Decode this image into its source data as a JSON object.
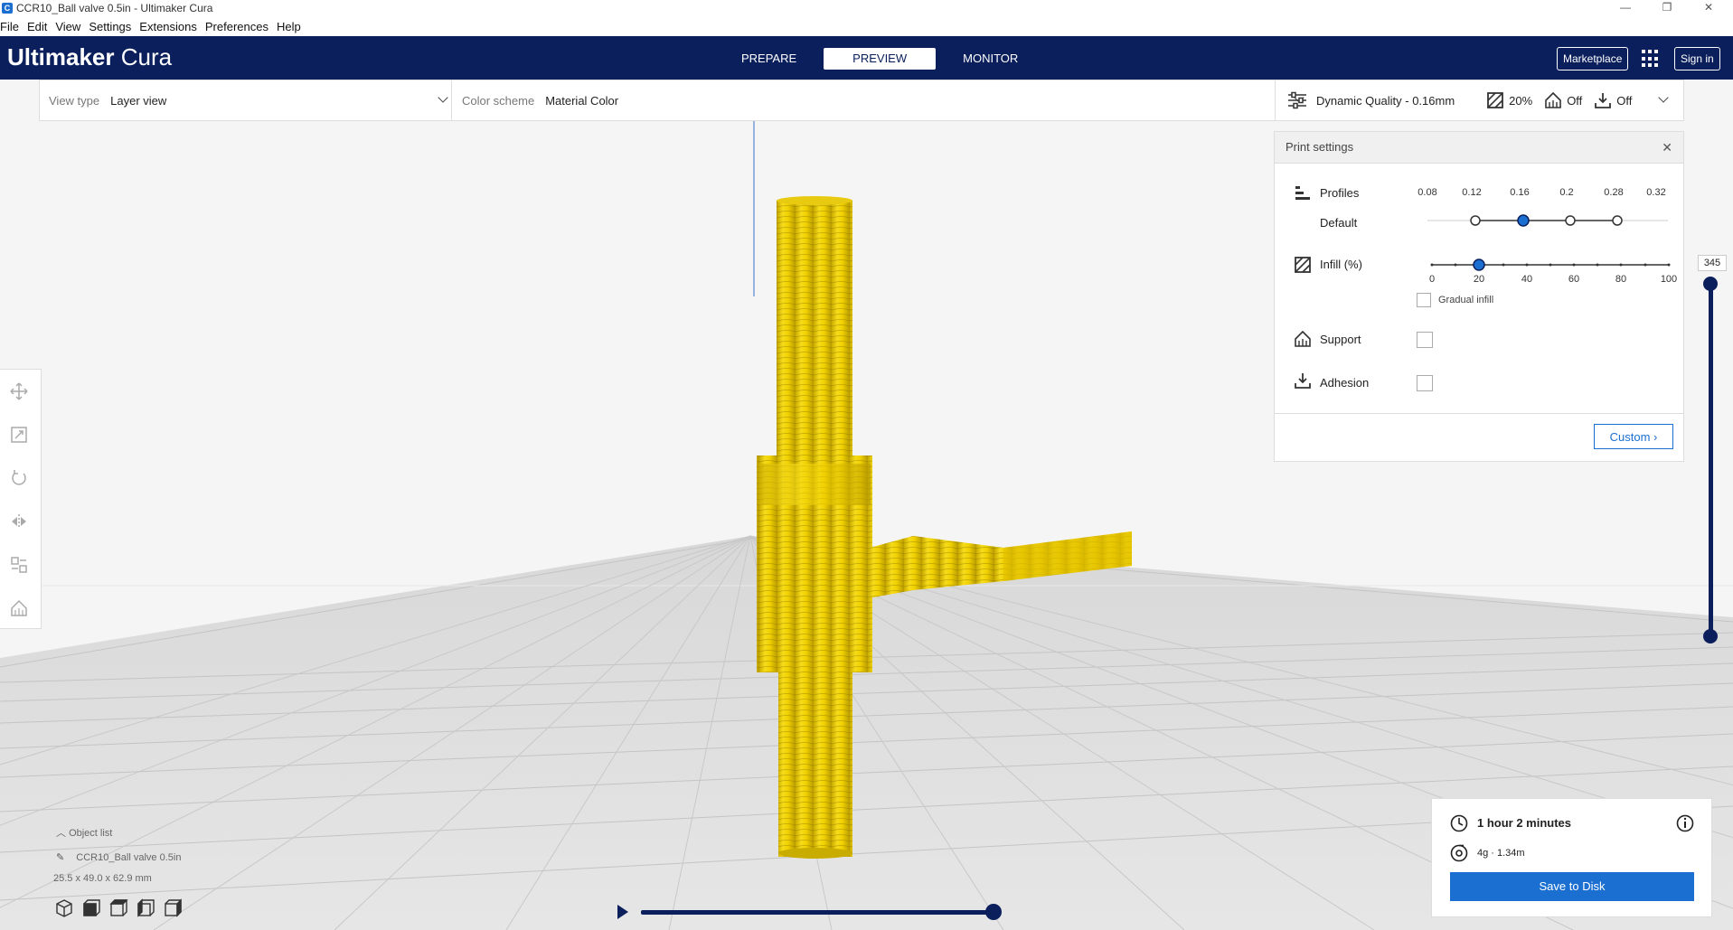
{
  "window": {
    "title": "CCR10_Ball valve 0.5in - Ultimaker Cura",
    "app_icon": "C"
  },
  "menu": [
    "File",
    "Edit",
    "View",
    "Settings",
    "Extensions",
    "Preferences",
    "Help"
  ],
  "header": {
    "brand_bold": "Ultimaker",
    "brand_light": " Cura",
    "tabs": [
      {
        "label": "PREPARE",
        "active": false
      },
      {
        "label": "PREVIEW",
        "active": true
      },
      {
        "label": "MONITOR",
        "active": false
      }
    ],
    "marketplace": "Marketplace",
    "signin": "Sign in"
  },
  "viewbar": {
    "view_type_label": "View type",
    "view_type_value": "Layer view",
    "color_scheme_label": "Color scheme",
    "color_scheme_value": "Material Color",
    "quality": "Dynamic Quality - 0.16mm",
    "infill": "20%",
    "support": "Off",
    "adhesion": "Off"
  },
  "print_settings": {
    "title": "Print settings",
    "profiles_label": "Profiles",
    "profile_default": "Default",
    "profile_ticks": [
      "0.08",
      "0.12",
      "0.16",
      "0.2",
      "0.28",
      "0.32"
    ],
    "selected_profile": "0.16",
    "infill_label": "Infill (%)",
    "infill_ticks": [
      "0",
      "20",
      "40",
      "60",
      "80",
      "100"
    ],
    "infill_value": 20,
    "gradual_infill": "Gradual infill",
    "support_label": "Support",
    "adhesion_label": "Adhesion",
    "custom": "Custom"
  },
  "layer_slider": {
    "max_layer": "345"
  },
  "object": {
    "list_label": "Object list",
    "name": "CCR10_Ball valve 0.5in",
    "dimensions": "25.5 x 49.0 x 62.9 mm"
  },
  "summary": {
    "time": "1 hour 2 minutes",
    "material": "4g · 1.34m",
    "save": "Save to Disk"
  },
  "colors": {
    "header": "#0a1f5c",
    "accent": "#1b6fd1",
    "material": "#f5d600"
  }
}
